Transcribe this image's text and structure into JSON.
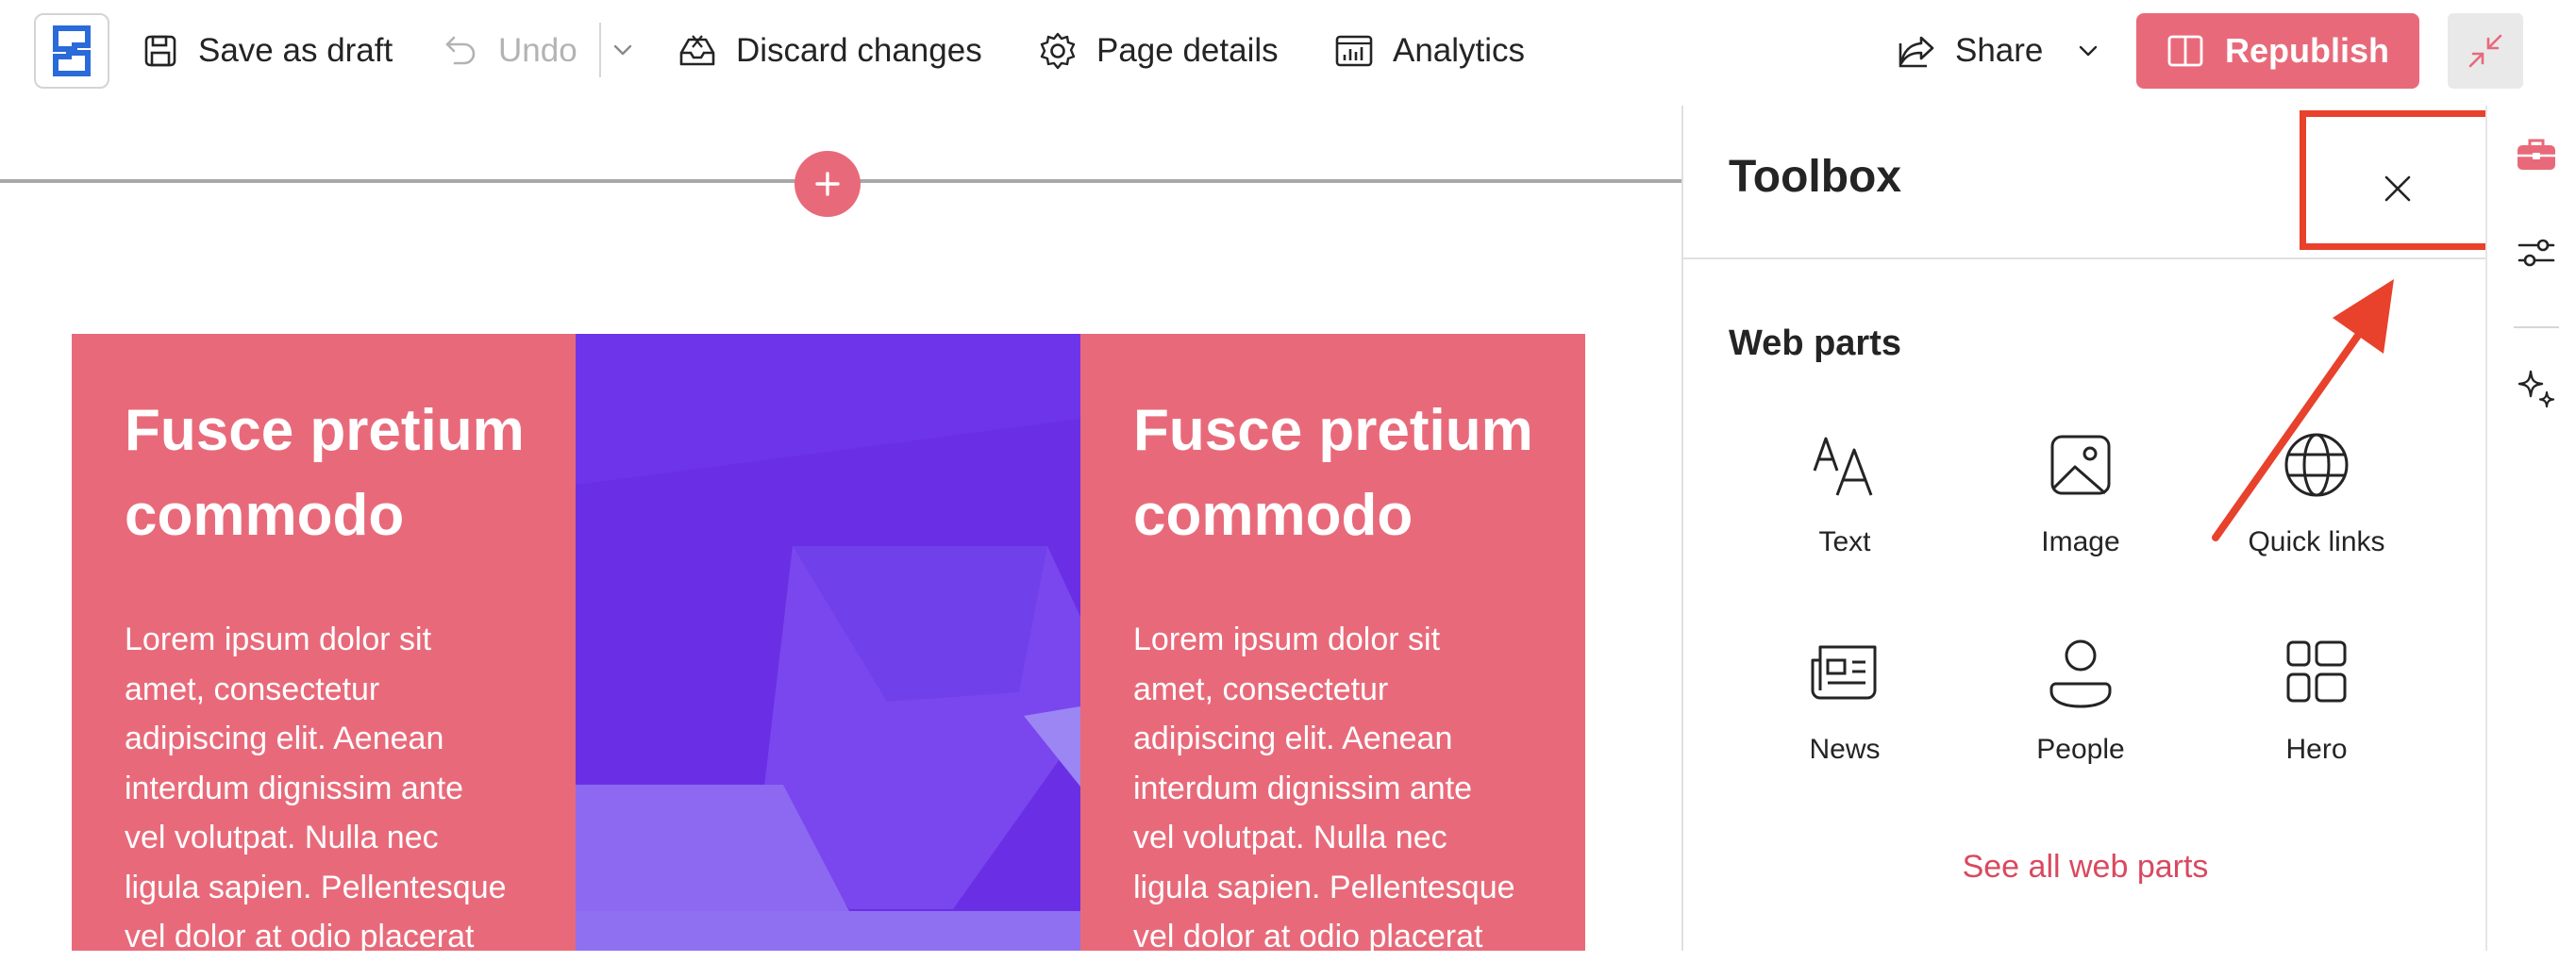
{
  "toolbar": {
    "logo_icon": "sharepoint-logo-icon",
    "save_draft_label": "Save as draft",
    "undo_label": "Undo",
    "discard_label": "Discard changes",
    "page_details_label": "Page details",
    "analytics_label": "Analytics",
    "share_label": "Share",
    "republish_label": "Republish"
  },
  "canvas": {
    "left_card": {
      "title_line1": "Fusce pretium",
      "title_line2": "commodo",
      "body_lines": [
        "Lorem ipsum dolor sit",
        "amet, consectetur",
        "adipiscing elit. Aenean",
        "interdum dignissim ante",
        "vel volutpat. Nulla nec",
        "ligula sapien. Pellentesque",
        "vel dolor at odio placerat"
      ]
    },
    "right_card": {
      "title_line1": "Fusce pretium",
      "title_line2": "commodo",
      "body_lines": [
        "Lorem ipsum dolor sit",
        "amet, consectetur",
        "adipiscing elit. Aenean",
        "interdum dignissim ante",
        "vel volutpat. Nulla nec",
        "ligula sapien. Pellentesque",
        "vel dolor at odio placerat"
      ]
    }
  },
  "toolbox": {
    "title": "Toolbox",
    "section_label": "Web parts",
    "items": [
      {
        "label": "Text",
        "icon": "text-icon"
      },
      {
        "label": "Image",
        "icon": "image-icon"
      },
      {
        "label": "Quick links",
        "icon": "globe-icon"
      },
      {
        "label": "News",
        "icon": "news-icon"
      },
      {
        "label": "People",
        "icon": "person-icon"
      },
      {
        "label": "Hero",
        "icon": "hero-icon"
      }
    ],
    "see_all_label": "See all web parts"
  },
  "colors": {
    "accent": "#e86a7a",
    "link": "#d9495f",
    "annotation": "#e8412c",
    "image_purple": "#6b2fe6"
  }
}
